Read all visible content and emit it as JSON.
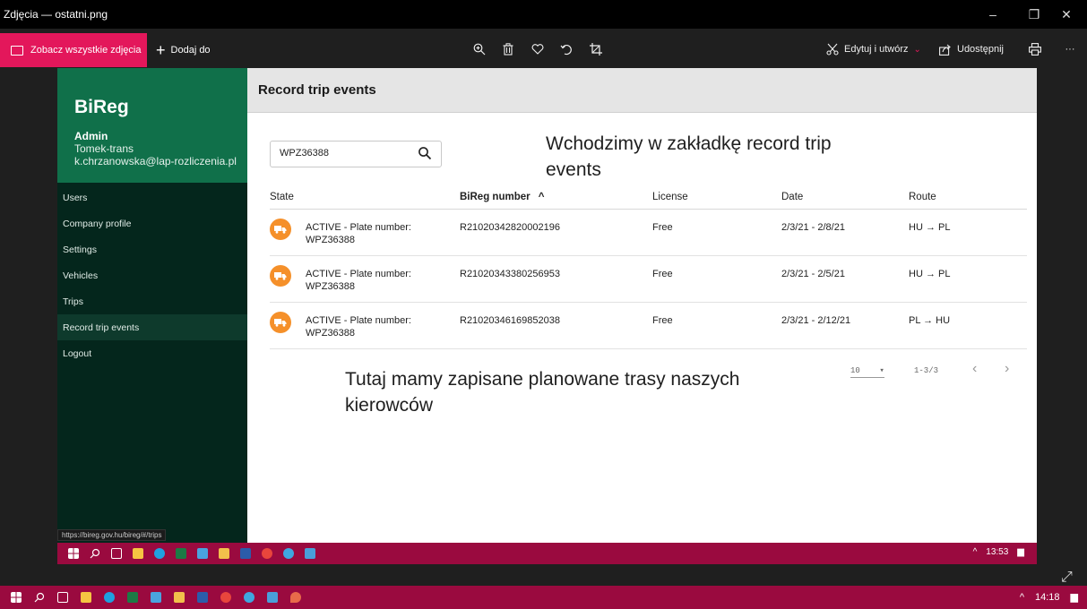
{
  "window": {
    "title": "Zdjęcia — ostatni.png",
    "controls": {
      "minimize": "–",
      "restore": "❐",
      "close": "✕"
    }
  },
  "toolbar": {
    "see_all_label": "Zobacz wszystkie zdjęcia",
    "add_to_label": "Dodaj do",
    "edit_create_label": "Edytuj i utwórz",
    "share_label": "Udostępnij",
    "more_label": "···",
    "icons": [
      "zoom-in-icon",
      "trash-icon",
      "heart-icon",
      "rotate-icon",
      "crop-icon",
      "print-icon"
    ]
  },
  "app": {
    "brand": "BiReg",
    "user": {
      "role": "Admin",
      "company": "Tomek-trans",
      "email": "k.chrzanowska@lap-rozliczenia.pl"
    },
    "nav": [
      {
        "label": "Users"
      },
      {
        "label": "Company profile"
      },
      {
        "label": "Settings"
      },
      {
        "label": "Vehicles"
      },
      {
        "label": "Trips"
      },
      {
        "label": "Record trip events"
      },
      {
        "label": "Logout"
      }
    ],
    "status_url": "https://bireg.gov.hu/bireg/#/trips",
    "page_title": "Record trip events",
    "search": {
      "value": "WPZ36388"
    },
    "table": {
      "headers": {
        "state": "State",
        "bireg": "BiReg number",
        "sort_indicator": "^",
        "license": "License",
        "date": "Date",
        "route": "Route"
      },
      "rows": [
        {
          "state_line1": "ACTIVE - Plate number:",
          "state_line2": "WPZ36388",
          "bireg": "R21020342820002196",
          "license": "Free",
          "date": "2/3/21 - 2/8/21",
          "route": "HU → PL"
        },
        {
          "state_line1": "ACTIVE - Plate number:",
          "state_line2": "WPZ36388",
          "bireg": "R21020343380256953",
          "license": "Free",
          "date": "2/3/21 - 2/5/21",
          "route": "HU → PL"
        },
        {
          "state_line1": "ACTIVE - Plate number:",
          "state_line2": "WPZ36388",
          "bireg": "R21020346169852038",
          "license": "Free",
          "date": "2/3/21 - 2/12/21",
          "route": "PL → HU"
        }
      ]
    },
    "pagination": {
      "per_page": "10",
      "range": "1-3/3",
      "prev": "‹",
      "next": "›"
    }
  },
  "annotations": {
    "top_line1": "Wchodzimy w zakładkę record trip",
    "top_line2": "events",
    "bottom_line1": "Tutaj mamy zapisane planowane trasy naszych",
    "bottom_line2": "kierowców"
  },
  "inner_taskbar": {
    "time": "13:53",
    "tray_chevron": "^"
  },
  "outer_taskbar": {
    "time": "14:18",
    "tray_chevron": "^"
  },
  "colors": {
    "photos_accent": "#e3175b",
    "sidebar_header": "#10704a",
    "sidebar_bg": "#04261c",
    "state_badge": "#f5902a",
    "taskbar": "#9a0a3f"
  }
}
